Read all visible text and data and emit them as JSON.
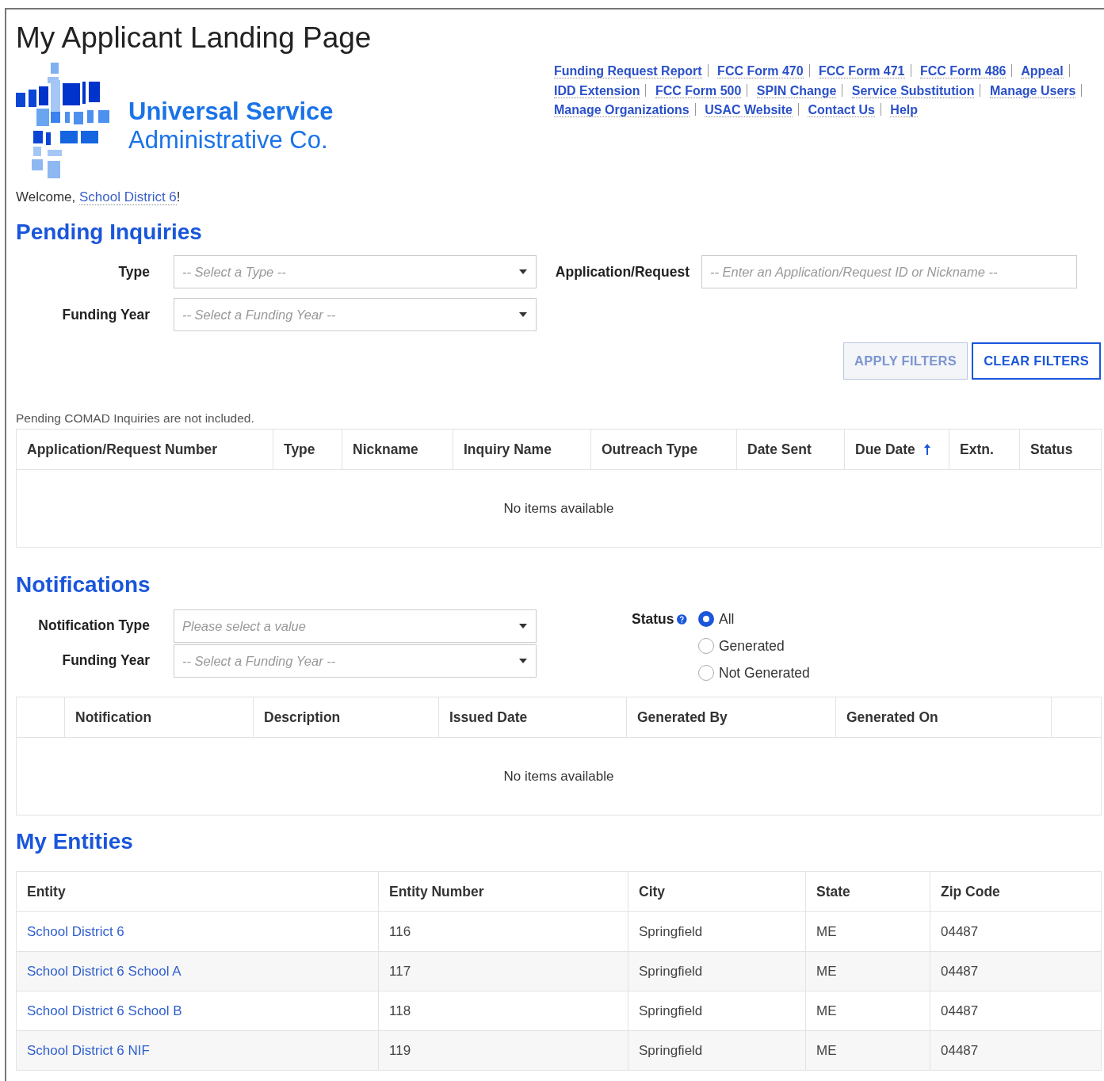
{
  "page_title": "My Applicant Landing Page",
  "logo": {
    "line_1": "Universal Service",
    "line_2": "Administrative Co."
  },
  "nav_links": [
    {
      "label": "Funding Request Report"
    },
    {
      "label": "FCC Form 470"
    },
    {
      "label": "FCC Form 471"
    },
    {
      "label": "FCC Form 486"
    },
    {
      "label": "Appeal"
    },
    {
      "label": "IDD Extension"
    },
    {
      "label": "FCC Form 500"
    },
    {
      "label": "SPIN Change"
    },
    {
      "label": "Service Substitution"
    },
    {
      "label": "Manage Users"
    },
    {
      "label": "Manage Organizations"
    },
    {
      "label": "USAC Website"
    },
    {
      "label": "Contact Us"
    },
    {
      "label": "Help"
    }
  ],
  "welcome": {
    "prefix": "Welcome,",
    "user": "School District 6",
    "suffix": "!"
  },
  "pending_inquiries": {
    "heading": "Pending Inquiries",
    "type_field": {
      "label": "Type",
      "placeholder": "-- Select a Type --"
    },
    "funding_year_field": {
      "label": "Funding Year",
      "placeholder": "-- Select a Funding Year --"
    },
    "application_field": {
      "label": "Application/Request",
      "placeholder": "-- Enter an Application/Request ID or Nickname --"
    },
    "buttons": [
      {
        "label": "APPLY FILTERS",
        "disabled": true
      },
      {
        "label": "CLEAR FILTERS",
        "disabled": false
      }
    ],
    "note": "Pending COMAD Inquiries are not included.",
    "table": {
      "columns": [
        {
          "label": "Application/Request Number",
          "sorted": false
        },
        {
          "label": "Type",
          "sorted": false
        },
        {
          "label": "Nickname",
          "sorted": false
        },
        {
          "label": "Inquiry Name",
          "sorted": false
        },
        {
          "label": "Outreach Type",
          "sorted": false
        },
        {
          "label": "Date Sent",
          "sorted": false
        },
        {
          "label": "Due Date",
          "sorted": true
        },
        {
          "label": "Extn.",
          "sorted": false
        },
        {
          "label": "Status",
          "sorted": false
        }
      ],
      "empty_message": "No items available"
    }
  },
  "notifications": {
    "heading": "Notifications",
    "type_field": {
      "label": "Notification Type",
      "placeholder": "Please select a value"
    },
    "funding_year_field": {
      "label": "Funding Year",
      "placeholder": "-- Select a Funding Year --"
    },
    "status": {
      "label": "Status",
      "options": [
        {
          "label": "All",
          "selected": true
        },
        {
          "label": "Generated",
          "selected": false
        },
        {
          "label": "Not Generated",
          "selected": false
        }
      ]
    },
    "table": {
      "columns": [
        "Notification",
        "Description",
        "Issued Date",
        "Generated By",
        "Generated On"
      ],
      "empty_message": "No items available"
    }
  },
  "my_entities": {
    "heading": "My Entities",
    "columns": [
      "Entity",
      "Entity Number",
      "City",
      "State",
      "Zip Code"
    ],
    "rows": [
      {
        "entity": "School District 6",
        "entity_number": "116",
        "city": "Springfield",
        "state": "ME",
        "zip": "04487"
      },
      {
        "entity": "School District 6 School A",
        "entity_number": "117",
        "city": "Springfield",
        "state": "ME",
        "zip": "04487"
      },
      {
        "entity": "School District 6 School B",
        "entity_number": "118",
        "city": "Springfield",
        "state": "ME",
        "zip": "04487"
      },
      {
        "entity": "School District 6 NIF",
        "entity_number": "119",
        "city": "Springfield",
        "state": "ME",
        "zip": "04487"
      }
    ]
  }
}
